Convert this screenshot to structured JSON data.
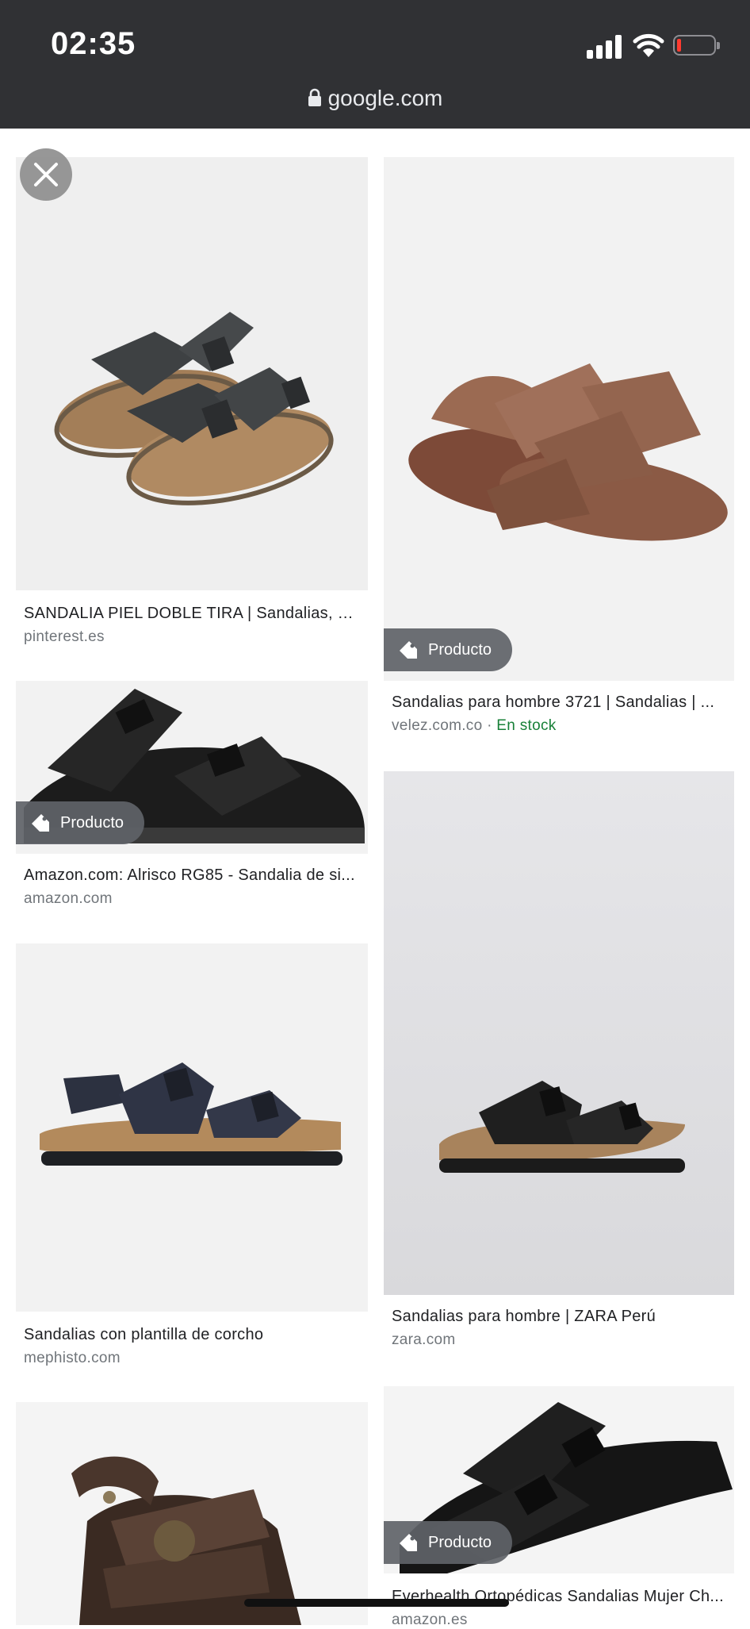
{
  "status_bar": {
    "time": "02:35"
  },
  "browser": {
    "url": "google.com"
  },
  "results": {
    "r1": {
      "title": "SANDALIA PIEL DOBLE TIRA | Sandalias, S...",
      "source": "pinterest.es"
    },
    "r2": {
      "badge": "Producto",
      "title": "Sandalias para hombre 3721 | Sandalias | ...",
      "source": "velez.com.co",
      "separator": " · ",
      "availability": "En stock"
    },
    "r3": {
      "badge": "Producto",
      "title": "Amazon.com: Alrisco RG85 - Sandalia de si...",
      "source": "amazon.com"
    },
    "r4": {
      "title": "Sandalias para hombre | ZARA Perú",
      "source": "zara.com"
    },
    "r5": {
      "title": "Sandalias con plantilla de corcho",
      "source": "mephisto.com"
    },
    "r6": {
      "badge": "Producto",
      "title": "Everhealth Ortopédicas Sandalias Mujer Ch...",
      "source": "amazon.es"
    }
  },
  "icons": {
    "close": "close-icon",
    "lock": "lock-icon",
    "tag": "tag-icon",
    "signal": "cellular-signal-icon",
    "wifi": "wifi-icon",
    "battery": "battery-icon"
  },
  "colors": {
    "top_bar": "#303134",
    "badge": "#5f6368",
    "in_stock": "#188038",
    "source_text": "#70757a",
    "battery_low": "#ff3b30"
  }
}
